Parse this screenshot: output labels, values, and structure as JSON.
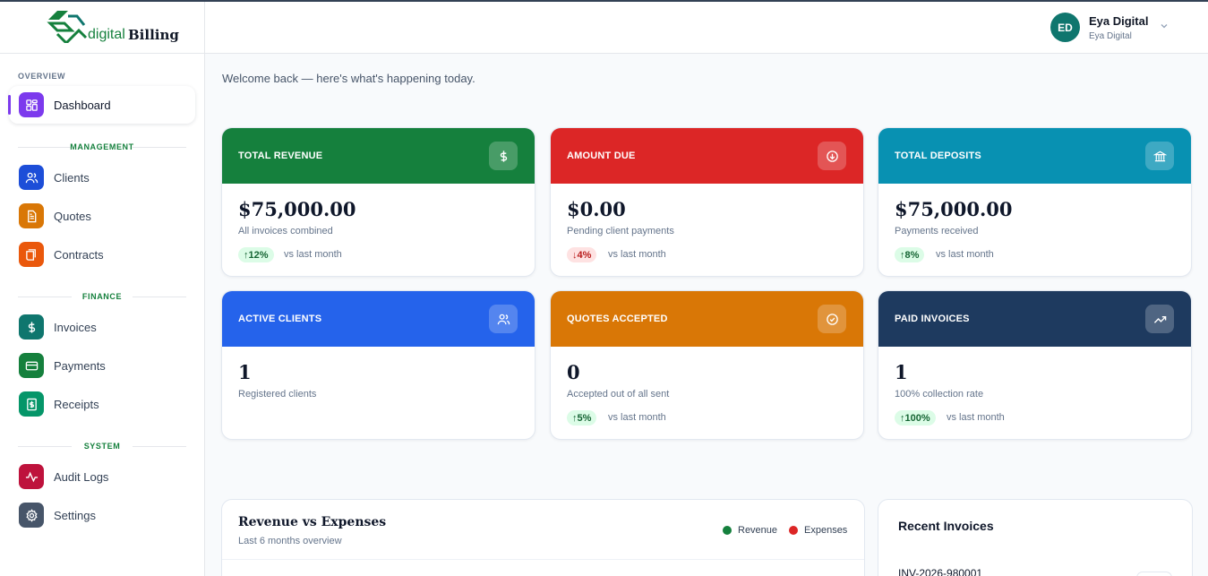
{
  "brand": {
    "text_primary": "digital",
    "text_secondary": "Billing",
    "accent": "#15803d"
  },
  "user": {
    "initials": "ED",
    "name": "Eya Digital",
    "org": "Eya Digital"
  },
  "welcome": "Welcome back — here's what's happening today.",
  "sidebar": {
    "sections": [
      {
        "title": "OVERVIEW"
      },
      {
        "title": "MANAGEMENT"
      },
      {
        "title": "FINANCE"
      },
      {
        "title": "SYSTEM"
      }
    ],
    "items": [
      {
        "label": "Dashboard",
        "icon": "grid-icon",
        "color": "#7c3aed",
        "active": true
      },
      {
        "label": "Clients",
        "icon": "users-icon",
        "color": "#1d4ed8"
      },
      {
        "label": "Quotes",
        "icon": "document-icon",
        "color": "#d97706"
      },
      {
        "label": "Contracts",
        "icon": "contract-icon",
        "color": "#ea580c"
      },
      {
        "label": "Invoices",
        "icon": "dollar-icon",
        "color": "#0f766e"
      },
      {
        "label": "Payments",
        "icon": "card-icon",
        "color": "#15803d"
      },
      {
        "label": "Receipts",
        "icon": "receipt-icon",
        "color": "#059669"
      },
      {
        "label": "Audit Logs",
        "icon": "activity-icon",
        "color": "#be123c"
      },
      {
        "label": "Settings",
        "icon": "gear-icon",
        "color": "#475569"
      }
    ]
  },
  "cards": [
    {
      "title": "TOTAL REVENUE",
      "value": "$75,000.00",
      "sub": "All invoices combined",
      "badge": "12%",
      "trend": "up",
      "note": "vs last month",
      "color": "#15803d",
      "icon": "dollar-icon"
    },
    {
      "title": "AMOUNT DUE",
      "value": "$0.00",
      "sub": "Pending client payments",
      "badge": "4%",
      "trend": "down",
      "note": "vs last month",
      "color": "#dc2626",
      "icon": "arrow-down-circle-icon"
    },
    {
      "title": "TOTAL DEPOSITS",
      "value": "$75,000.00",
      "sub": "Payments received",
      "badge": "8%",
      "trend": "up",
      "note": "vs last month",
      "color": "#0891b2",
      "icon": "bank-icon"
    },
    {
      "title": "ACTIVE CLIENTS",
      "value": "1",
      "sub": "Registered clients",
      "color": "#2563eb",
      "icon": "users-icon"
    },
    {
      "title": "QUOTES ACCEPTED",
      "value": "0",
      "sub": "Accepted out of all sent",
      "badge": "5%",
      "trend": "up",
      "note": "vs last month",
      "color": "#d97706",
      "icon": "check-circle-icon"
    },
    {
      "title": "PAID INVOICES",
      "value": "1",
      "sub": "100% collection rate",
      "badge": "100%",
      "trend": "up",
      "note": "vs last month",
      "color": "#1e3a5f",
      "icon": "trending-up-icon"
    }
  ],
  "chart_panel": {
    "title": "Revenue vs Expenses",
    "subtitle": "Last 6 months overview",
    "legend": [
      {
        "label": "Revenue",
        "color": "#15803d"
      },
      {
        "label": "Expenses",
        "color": "#dc2626"
      }
    ]
  },
  "recent_invoices": {
    "title": "Recent Invoices",
    "first_number": "INV-2026-980001"
  }
}
